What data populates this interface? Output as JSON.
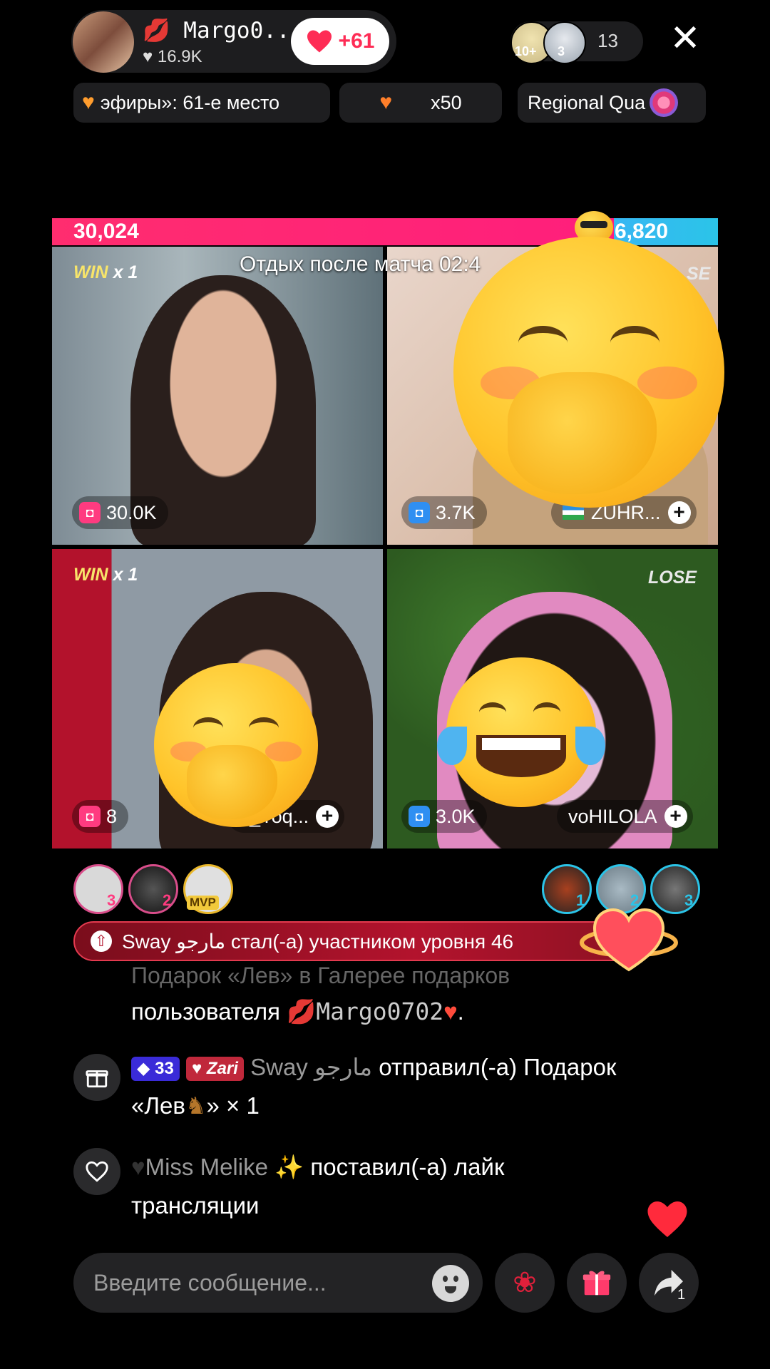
{
  "header": {
    "host_name": "Margo0...",
    "host_likes": "16.9K",
    "follow_label": "+61",
    "viewer_badges": [
      "10+",
      "3"
    ],
    "viewer_count": "13",
    "close_icon": "close-icon"
  },
  "chips": [
    {
      "text": "эфиры»: 61-е место",
      "icon": "orange-heart-icon"
    },
    {
      "text": "x50",
      "icon": "heart-planet-icon"
    },
    {
      "text": "Regional Qua",
      "icon": "lollipop-icon"
    }
  ],
  "battle": {
    "left_score": "30,024",
    "right_score": "6,820",
    "break_label": "Отдых после матча  02:4",
    "cells": [
      {
        "tag_word": "WIN",
        "tag_mult": "x 1",
        "score": "30.0K",
        "name": ""
      },
      {
        "tag_word": "SE",
        "score": "3.7K",
        "name": "ZUHR..."
      },
      {
        "tag_word": "WIN",
        "tag_mult": "x 1",
        "score": "8",
        "name": "a_Yoq..."
      },
      {
        "tag_word": "LOSE",
        "score": "3.0K",
        "name": "voHILOLA"
      }
    ]
  },
  "gifters_left": [
    "3",
    "2",
    "MVP"
  ],
  "gifters_right": [
    "1",
    "2",
    "3"
  ],
  "level_banner": "Sway مارجو стал(-а) участником уровня 46",
  "chat": {
    "faded_line": "Подарок «Лев» в Галерее подарков",
    "line1_text": "пользователя",
    "line1_user": "Margo0702",
    "line2_badge_level": "33",
    "line2_badge_fan": "Zari",
    "line2_user": "Sway مارجو",
    "line2_text": "отправил(-а) Подарок",
    "line2_text2": "«Лев",
    "line2_text3": "» × 1",
    "line3_user": "Miss Melike",
    "line3_text": "поставил(-а) лайк",
    "line3_text2": "трансляции"
  },
  "bottom": {
    "input_placeholder": "Введите сообщение...",
    "share_count": "1"
  },
  "colors": {
    "pink": "#fe2c55",
    "red_score": "#ff1e7c",
    "blue_score": "#2bc4e8",
    "win_yellow": "#f7e46a"
  }
}
